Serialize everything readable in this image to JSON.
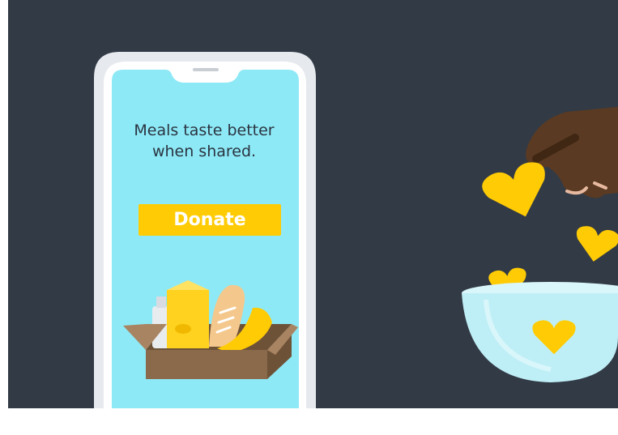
{
  "phone": {
    "headline_line1": "Meals taste better",
    "headline_line2": "when shared.",
    "donate_label": "Donate"
  },
  "colors": {
    "background": "#323a46",
    "phone_screen": "#8ee9f6",
    "accent_yellow": "#ffcb05",
    "box_brown": "#8a6a4a",
    "bowl": "#bfeff6",
    "hand": "#5a3a22"
  },
  "icons": [
    "heart-icon",
    "grocery-box",
    "hand",
    "bowl"
  ]
}
